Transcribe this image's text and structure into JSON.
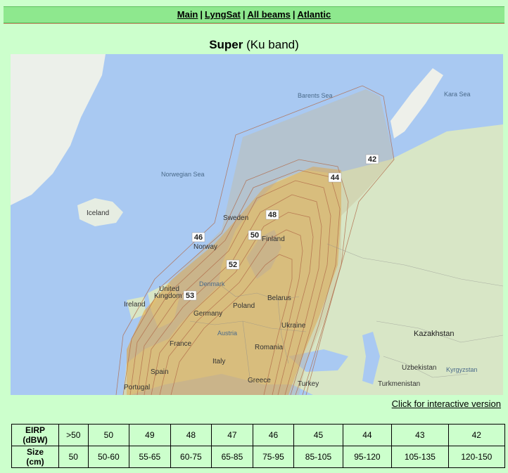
{
  "nav": {
    "main": "Main",
    "lyngsat": "LyngSat",
    "all_beams": "All beams",
    "atlantic": "Atlantic",
    "sep": "|"
  },
  "title": {
    "name": "Super",
    "band": "(Ku band)"
  },
  "map": {
    "labels": {
      "barents_sea": "Barents Sea",
      "kara_sea": "Kara Sea",
      "norwegian_sea": "Norwegian Sea",
      "iceland": "Iceland",
      "sweden": "Sweden",
      "finland": "Finland",
      "norway": "Norway",
      "united_kingdom_1": "United",
      "united_kingdom_2": "Kingdom",
      "denmark": "Denmark",
      "ireland": "Ireland",
      "belarus": "Belarus",
      "poland": "Poland",
      "germany": "Germany",
      "ukraine": "Ukraine",
      "austria": "Austria",
      "france": "France",
      "romania": "Romania",
      "italy": "Italy",
      "spain": "Spain",
      "greece": "Greece",
      "portugal": "Portugal",
      "turkey": "Turkey",
      "turkmenistan": "Turkmenistan",
      "uzbekistan": "Uzbekistan",
      "kyrgyzstan": "Kyrgyzstan",
      "kazakhstan": "Kazakhstan"
    },
    "contours": {
      "c42": "42",
      "c44": "44",
      "c46": "46",
      "c48": "48",
      "c50": "50",
      "c52": "52",
      "c53": "53"
    }
  },
  "interactive_link": "Click for interactive version",
  "table": {
    "eirp_header": [
      "EIRP",
      "(dBW)"
    ],
    "size_header": [
      "Size",
      "(cm)"
    ],
    "eirp": [
      ">50",
      "50",
      "49",
      "48",
      "47",
      "46",
      "45",
      "44",
      "43",
      "42"
    ],
    "size": [
      "50",
      "50-60",
      "55-65",
      "60-75",
      "65-85",
      "75-95",
      "85-105",
      "95-120",
      "105-135",
      "120-150"
    ]
  }
}
